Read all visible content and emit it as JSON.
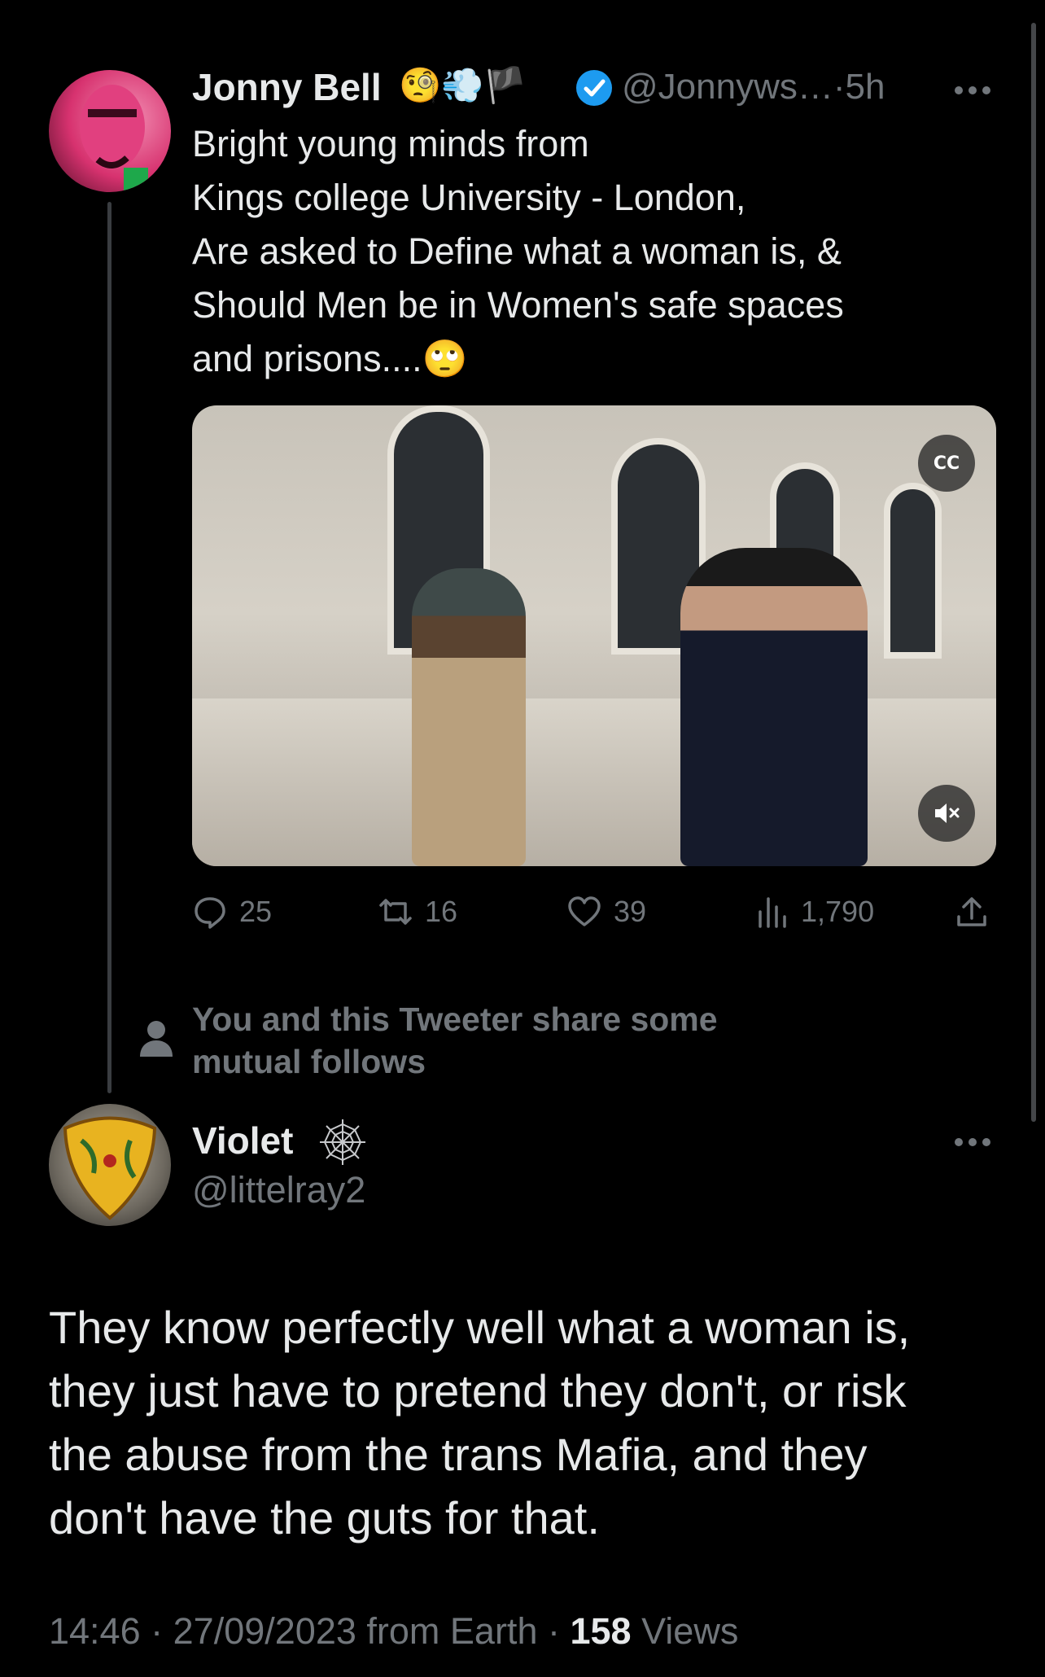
{
  "thread": {
    "author": {
      "name": "Jonny Bell",
      "name_emojis": "🧐💨🏴",
      "verified": true,
      "handle": "@Jonnyws…",
      "separator": "·",
      "time": "5h",
      "avatar_icon": "profile-avatar"
    },
    "text_lines": [
      "Bright young minds from",
      "Kings college University - London,",
      "Are asked to Define what a woman is, &",
      "Should Men be in Women's safe spaces",
      "and prisons...."
    ],
    "text_emoji": "🙄",
    "media": {
      "caption_button_label": "CC",
      "mute_icon": "muted-speaker-icon"
    },
    "actions": {
      "replies": "25",
      "reposts": "16",
      "likes": "39",
      "views": "1,790"
    },
    "mutual_lines": [
      "You and this Tweeter share some",
      "mutual follows"
    ]
  },
  "reply": {
    "name": "Violet",
    "name_icon": "spider-web-icon",
    "handle": "@littelray2",
    "text_lines": [
      "They know perfectly well what a woman is,",
      "they just have to pretend they don't, or risk",
      "the abuse from the trans Mafia, and they",
      "don't have the guts for that."
    ],
    "meta": {
      "time": "14:46",
      "date": "27/09/2023",
      "source": "from Earth",
      "views_count": "158",
      "views_label": "Views",
      "dot": "·"
    }
  },
  "colors": {
    "background": "#000000",
    "text": "#e7e9ea",
    "muted": "#71767b",
    "verified": "#1d9bf0"
  }
}
